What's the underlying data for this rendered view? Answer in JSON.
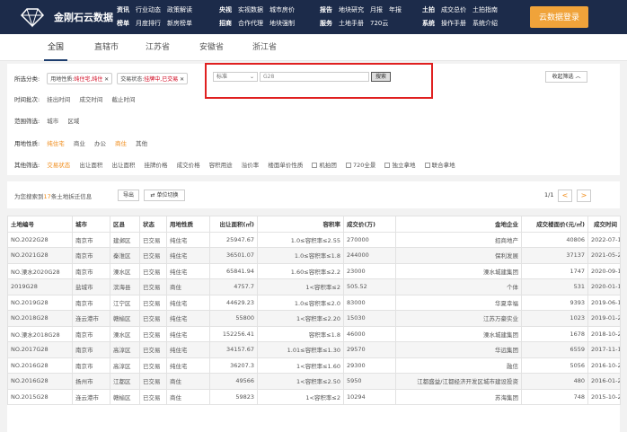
{
  "header": {
    "logo_text": "金刚石云数据",
    "nav_groups": [
      {
        "row1": [
          "资讯",
          "行业动态",
          "政策解读"
        ],
        "row2": [
          "榜单",
          "月度排行",
          "新房榜单"
        ]
      },
      {
        "row1": [
          "央视",
          "实视数据",
          "城市房价"
        ],
        "row2": [
          "招商",
          "合作代理",
          "地块强制"
        ]
      },
      {
        "row1": [
          "报告",
          "地块研究",
          "月报",
          "年报"
        ],
        "row2": [
          "服务",
          "土地手册",
          "720云"
        ]
      },
      {
        "row1": [
          "土拍",
          "成交总价",
          "土拍指南"
        ],
        "row2": [
          "系统",
          "操作手册",
          "系统介绍"
        ]
      }
    ],
    "login_label": "云数据登录"
  },
  "tabs": [
    "全国",
    "直辖市",
    "江苏省",
    "安徽省",
    "浙江省"
  ],
  "filters": {
    "row1_label": "所选分类:",
    "chips": [
      {
        "key": "用地性质:",
        "value": "纯住宅,纯住"
      },
      {
        "key": "交易状态:",
        "value": "挂牌中,已交易"
      }
    ],
    "row2_label": "时间批次:",
    "row2_options": [
      "挂出时间",
      "成交时间",
      "截止时间"
    ],
    "row3_label": "范围筛选:",
    "row3_options": [
      "城市",
      "区域"
    ],
    "row4_label": "用地性质:",
    "row4_options": [
      "纯住宅",
      "商业",
      "办公",
      "商住",
      "其他"
    ],
    "row5_label": "其他筛选:",
    "row5_options": [
      "交易状态",
      "出让面积",
      "出让面积",
      "挂牌价格",
      "成交价格",
      "容积用途",
      "溢价率",
      "楼面单价性质"
    ],
    "checkboxes": [
      "机拍团",
      "720全景",
      "独立拿地",
      "联合拿地"
    ]
  },
  "search": {
    "select_value": "标准",
    "input_value": "G28",
    "button_label": "搜索"
  },
  "collapse_label": "收起筛选 ︿",
  "results": {
    "prefix": "为您搜索到",
    "count": "17",
    "suffix": "条土地拆迁信息",
    "export_label": "导出",
    "unit_label": "单位切换",
    "page_info": "1/1",
    "prev": "<",
    "next": ">"
  },
  "table": {
    "headers": [
      "土地编号",
      "城市",
      "区县",
      "状态",
      "用地性质",
      "出让面积(㎡)",
      "容积率",
      "成交价(万)",
      "金地企业",
      "成交楼面价(元/㎡)",
      "成交时间"
    ],
    "rows": [
      [
        "NO.2022G28",
        "南京市",
        "建邺区",
        "已交易",
        "纯住宅",
        "25947.67",
        "1.0≤容积率≤2.55",
        "270000",
        "招商地产",
        "40806",
        "2022-07-13"
      ],
      [
        "NO.2021G28",
        "南京市",
        "秦淮区",
        "已交易",
        "纯住宅",
        "36501.07",
        "1.0≤容积率≤1.8",
        "244000",
        "保利发展",
        "37137",
        "2021-05-22"
      ],
      [
        "NO.溧水2020G28",
        "南京市",
        "溧水区",
        "已交易",
        "纯住宅",
        "65841.94",
        "1.60≤容积率≤2.2",
        "23000",
        "溧水城建集团",
        "1747",
        "2020-09-10"
      ],
      [
        "2019G28",
        "盐城市",
        "滨海县",
        "已交易",
        "商住",
        "4757.7",
        "1<容积率≤2",
        "505.52",
        "个体",
        "531",
        "2020-01-13"
      ],
      [
        "NO.2019G28",
        "南京市",
        "江宁区",
        "已交易",
        "纯住宅",
        "44629.23",
        "1.0≤容积率≤2.0",
        "83000",
        "华夏幸福",
        "9393",
        "2019-06-18"
      ],
      [
        "NO.2018G28",
        "连云港市",
        "赣榆区",
        "已交易",
        "纯住宅",
        "55800",
        "1<容积率≤2.20",
        "15030",
        "江苏万豪实业",
        "1023",
        "2019-01-28"
      ],
      [
        "NO.溧水2018G28",
        "南京市",
        "溧水区",
        "已交易",
        "纯住宅",
        "152256.41",
        "容积率≤1.8",
        "46000",
        "溧水城建集团",
        "1678",
        "2018-10-26"
      ],
      [
        "NO.2017G28",
        "南京市",
        "高淳区",
        "已交易",
        "纯住宅",
        "34157.67",
        "1.01≤容积率≤1.30",
        "29570",
        "华远集团",
        "6559",
        "2017-11-14"
      ],
      [
        "NO.2016G28",
        "南京市",
        "高淳区",
        "已交易",
        "纯住宅",
        "36207.3",
        "1<容积率≤1.60",
        "29300",
        "融信",
        "5056",
        "2016-10-25"
      ],
      [
        "NO.2016G28",
        "扬州市",
        "江都区",
        "已交易",
        "商住",
        "49566",
        "1<容积率≤2.50",
        "5950",
        "江都盛益/江都经济开发区城市建设投资",
        "480",
        "2016-01-22"
      ],
      [
        "NO.2015G28",
        "连云港市",
        "赣榆区",
        "已交易",
        "商住",
        "59823",
        "1<容积率≤2",
        "10294",
        "苏海集团",
        "748",
        "2015-10-28"
      ]
    ]
  }
}
